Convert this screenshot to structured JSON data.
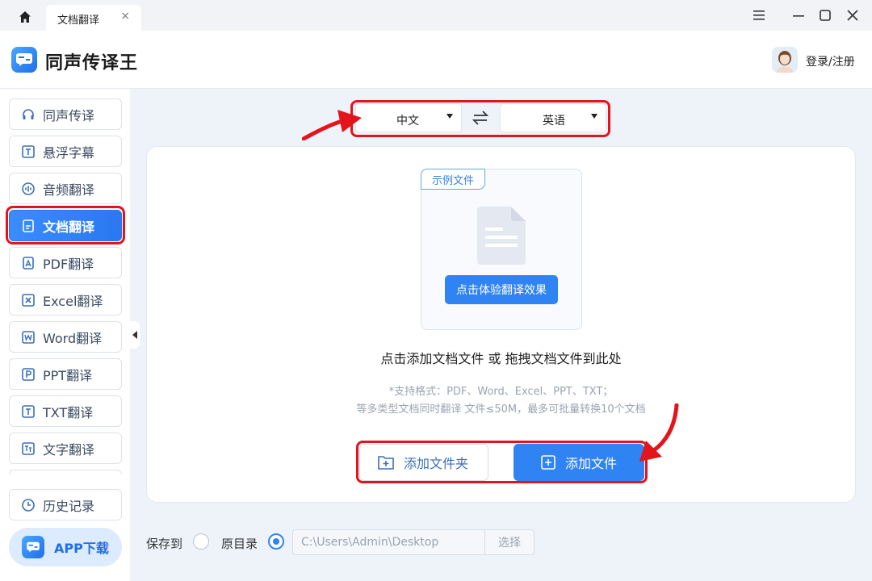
{
  "titlebar": {
    "tab_label": "文档翻译",
    "tab_close": "×"
  },
  "header": {
    "app_name": "同声传译王",
    "login_label": "登录/注册"
  },
  "sidebar": {
    "items": [
      {
        "label": "同声传译",
        "icon": "headphones-icon"
      },
      {
        "label": "悬浮字幕",
        "icon": "text-t-icon"
      },
      {
        "label": "音频翻译",
        "icon": "audio-wave-icon"
      },
      {
        "label": "文档翻译",
        "icon": "document-icon",
        "active": true
      },
      {
        "label": "PDF翻译",
        "icon": "pdf-icon"
      },
      {
        "label": "Excel翻译",
        "icon": "excel-icon"
      },
      {
        "label": "Word翻译",
        "icon": "word-icon"
      },
      {
        "label": "PPT翻译",
        "icon": "ppt-icon"
      },
      {
        "label": "TXT翻译",
        "icon": "txt-icon"
      },
      {
        "label": "文字翻译",
        "icon": "translate-icon"
      }
    ],
    "history_label": "历史记录",
    "app_download_label": "APP下载"
  },
  "language": {
    "source": "中文",
    "target": "英语"
  },
  "main": {
    "sample_tag": "示例文件",
    "try_button": "点击体验翻译效果",
    "drop_hint": "点击添加文档文件 或 拖拽文档文件到此处",
    "format_line1": "*支持格式：PDF、Word、Excel、PPT、TXT；",
    "format_line2": "等多类型文档同时翻译 文件≤50M，最多可批量转换10个文档",
    "add_folder_label": "添加文件夹",
    "add_file_label": "添加文件"
  },
  "save": {
    "save_to_label": "保存到",
    "original_dir_label": "原目录",
    "path_value": "C:\\Users\\Admin\\Desktop",
    "choose_label": "选择"
  },
  "colors": {
    "accent": "#2f83f2",
    "annotation_red": "#e3141b"
  }
}
